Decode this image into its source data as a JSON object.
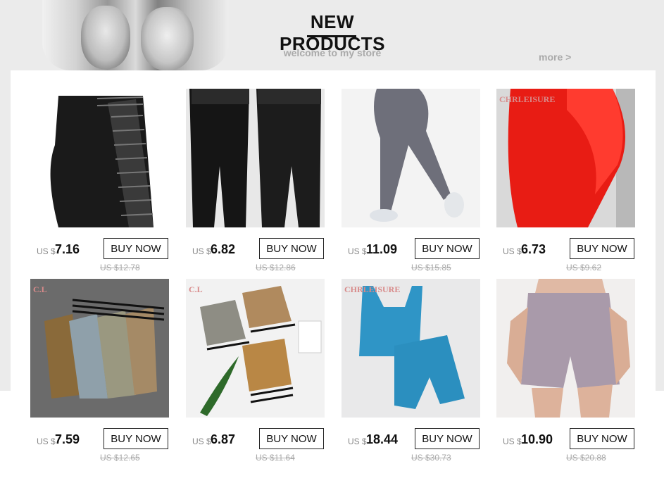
{
  "header": {
    "title": "NEW PRODUCTS",
    "subtitle": "welcome to my store",
    "more_link": "more >"
  },
  "products": [
    {
      "currency": "US $",
      "price": "7.16",
      "old_price": "US $12.78",
      "button": "BUY NOW",
      "brand": "",
      "image": "black striped leggings"
    },
    {
      "currency": "US $",
      "price": "6.82",
      "old_price": "US $12.86",
      "button": "BUY NOW",
      "brand": "",
      "image": "black textured leggings"
    },
    {
      "currency": "US $",
      "price": "11.09",
      "old_price": "US $15.85",
      "button": "BUY NOW",
      "brand": "",
      "image": "gray leggings"
    },
    {
      "currency": "US $",
      "price": "6.73",
      "old_price": "US $9.62",
      "button": "BUY NOW",
      "brand": "CHRLEISURE",
      "image": "red textured leggings"
    },
    {
      "currency": "US $",
      "price": "7.59",
      "old_price": "US $12.65",
      "button": "BUY NOW",
      "brand": "C.L",
      "image": "snake print leggings"
    },
    {
      "currency": "US $",
      "price": "6.87",
      "old_price": "US $11.64",
      "button": "BUY NOW",
      "brand": "C.L",
      "image": "animal print sports bras"
    },
    {
      "currency": "US $",
      "price": "18.44",
      "old_price": "US $30.73",
      "button": "BUY NOW",
      "brand": "CHRLEISURE",
      "image": "blue sports set"
    },
    {
      "currency": "US $",
      "price": "10.90",
      "old_price": "US $20.88",
      "button": "BUY NOW",
      "brand": "",
      "image": "lavender shorts"
    }
  ]
}
